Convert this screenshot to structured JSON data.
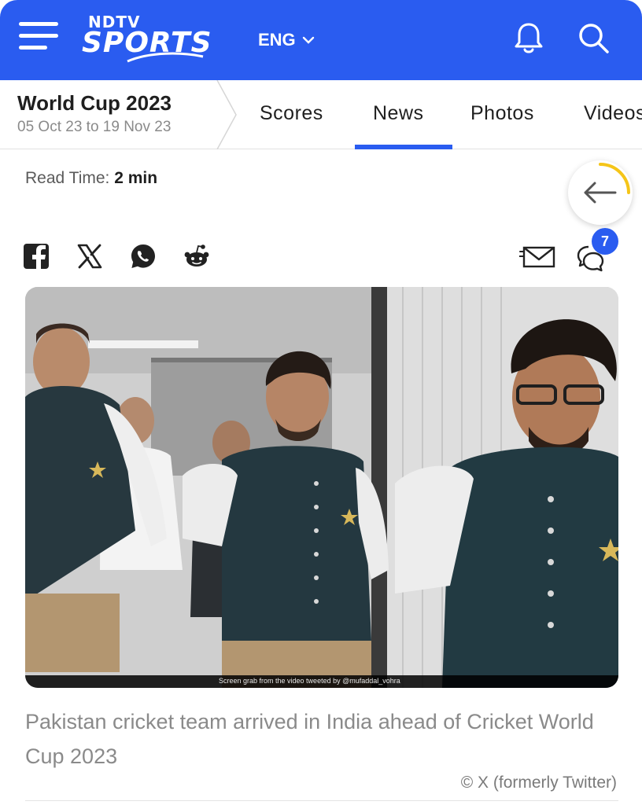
{
  "header": {
    "logo_top": "NDTV",
    "logo_main": "SPORTS",
    "language": "ENG"
  },
  "series": {
    "title": "World Cup 2023",
    "dates": "05 Oct 23 to 19 Nov 23"
  },
  "tabs": [
    {
      "label": "Scores"
    },
    {
      "label": "News",
      "active": true
    },
    {
      "label": "Photos"
    },
    {
      "label": "Videos"
    }
  ],
  "article": {
    "read_time_label": "Read Time:",
    "read_time_value": "2 min",
    "comment_count": "7",
    "image_overlay_text": "Screen grab from the video tweeted by @mufaddal_vohra",
    "caption": "Pakistan cricket team arrived in India ahead of Cricket World Cup 2023",
    "credit": "© X (formerly Twitter)"
  },
  "share_icons": [
    "facebook-icon",
    "x-icon",
    "whatsapp-icon",
    "reddit-icon",
    "mail-icon",
    "comment-icon"
  ],
  "colors": {
    "brand_blue": "#2a5cf0",
    "progress_yellow": "#f5c518"
  }
}
